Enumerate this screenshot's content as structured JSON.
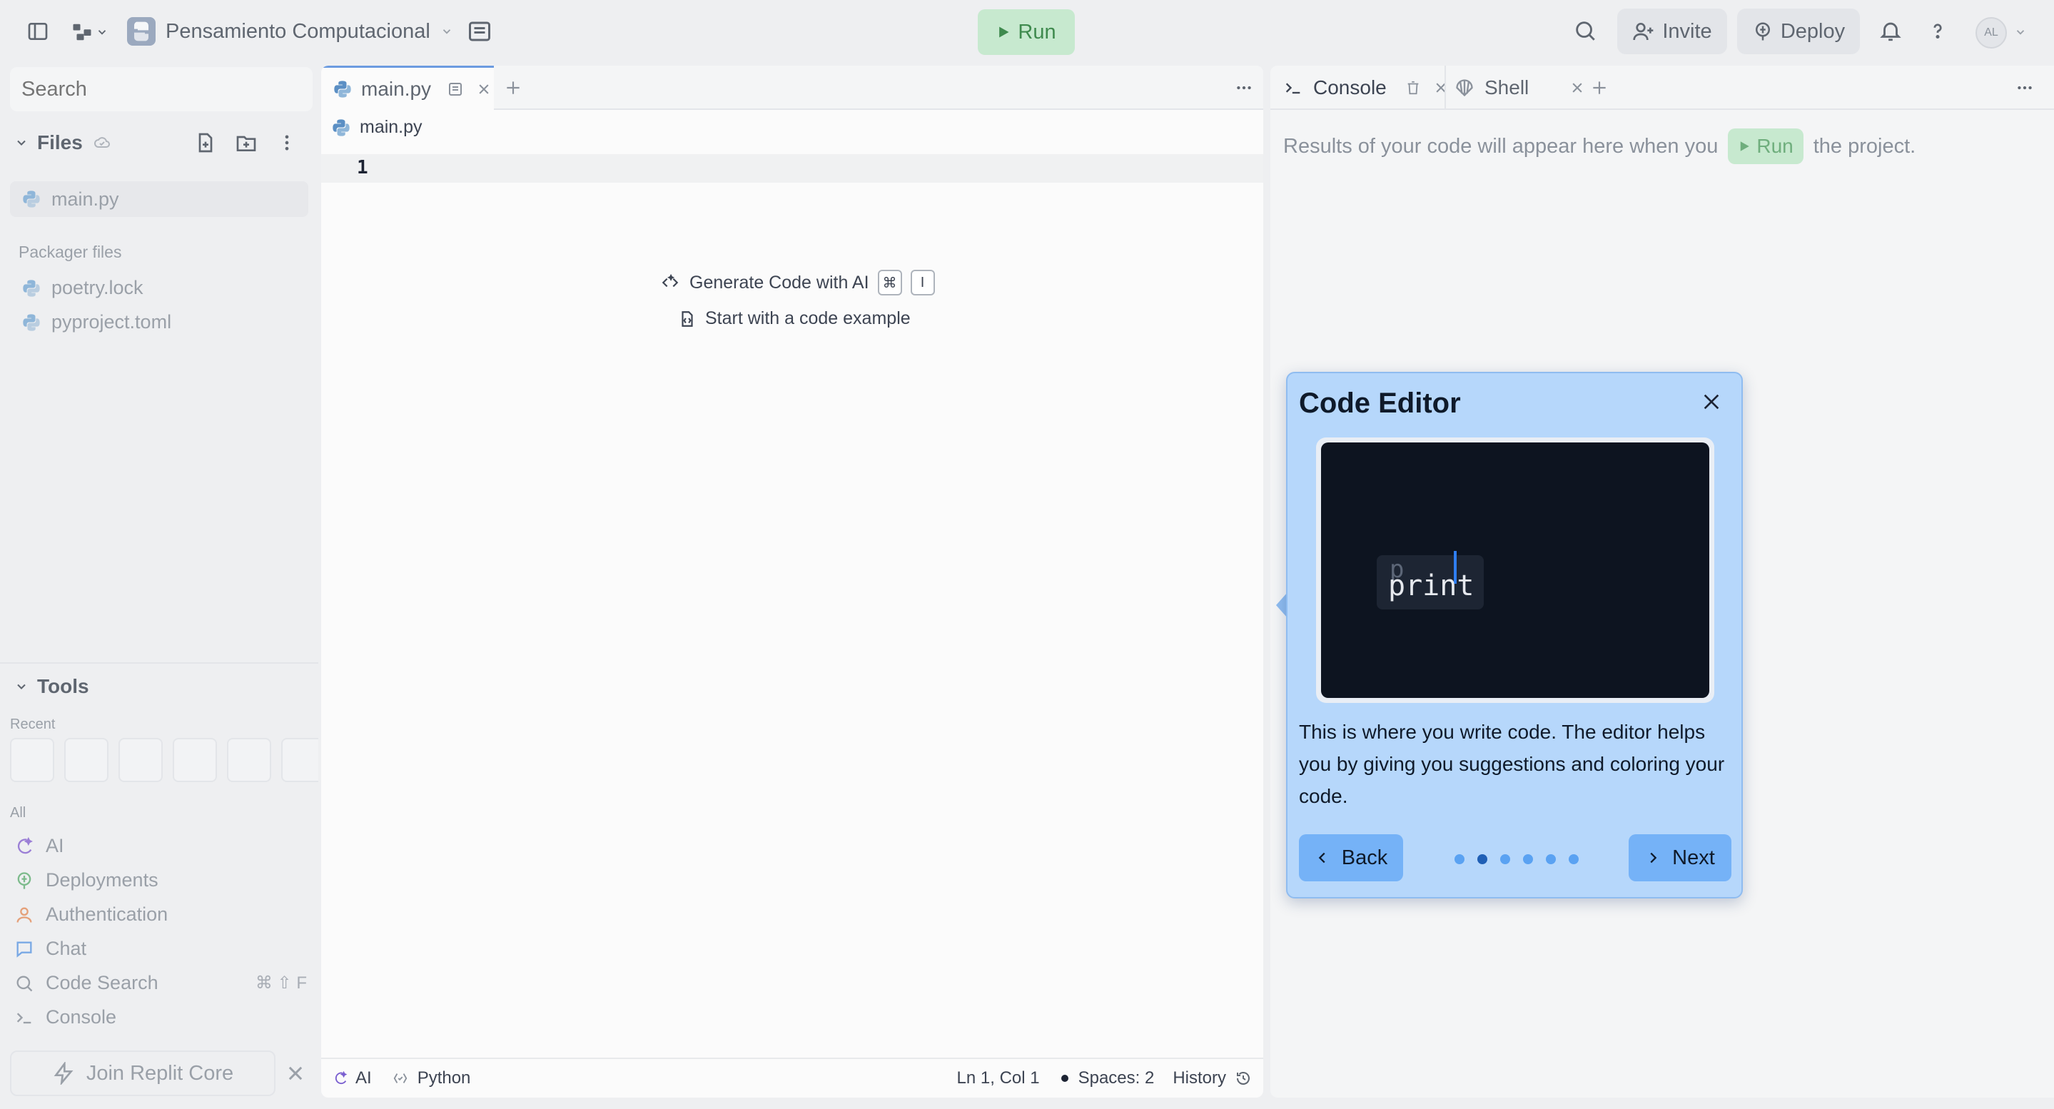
{
  "topbar": {
    "project_name": "Pensamiento Computacional",
    "run_label": "Run",
    "invite_label": "Invite",
    "deploy_label": "Deploy",
    "avatar_initials": "AL"
  },
  "sidebar": {
    "search_placeholder": "Search",
    "files_heading": "Files",
    "files": [
      {
        "name": "main.py"
      }
    ],
    "packager_heading": "Packager files",
    "packager_files": [
      {
        "name": "poetry.lock"
      },
      {
        "name": "pyproject.toml"
      }
    ],
    "tools_heading": "Tools",
    "recent_label": "Recent",
    "all_label": "All",
    "tools": [
      {
        "label": "AI",
        "icon": "ai-icon"
      },
      {
        "label": "Deployments",
        "icon": "deploy-icon"
      },
      {
        "label": "Authentication",
        "icon": "user-icon"
      },
      {
        "label": "Chat",
        "icon": "chat-icon"
      },
      {
        "label": "Code Search",
        "icon": "search-icon",
        "shortcut": "⌘ ⇧ F"
      },
      {
        "label": "Console",
        "icon": "terminal-icon"
      }
    ],
    "join_label": "Join Replit Core"
  },
  "editor": {
    "tab_label": "main.py",
    "breadcrumb": "main.py",
    "line_number": "1",
    "generate_hint": "Generate Code with AI",
    "kbd_1": "⌘",
    "kbd_2": "I",
    "example_hint": "Start with a code example",
    "status": {
      "ai": "AI",
      "language": "Python",
      "position": "Ln 1, Col 1",
      "spaces": "Spaces: 2",
      "history": "History"
    }
  },
  "console": {
    "tab_console": "Console",
    "tab_shell": "Shell",
    "message_before": "Results of your code will appear here when you",
    "run_label": "Run",
    "message_after": "the project."
  },
  "tour": {
    "title": "Code Editor",
    "demo_typed": "p",
    "demo_suggestion": "print",
    "body": "This is where you write code. The editor helps you by giving you suggestions and coloring your code.",
    "back_label": "Back",
    "next_label": "Next",
    "step_current": 2,
    "step_total": 6
  },
  "colors": {
    "run_bg": "#c7e9cf",
    "run_text": "#3f8a4e",
    "tour_bg": "#b6d7fb",
    "tour_button": "#75b2f7",
    "accent": "#6b9be0"
  }
}
